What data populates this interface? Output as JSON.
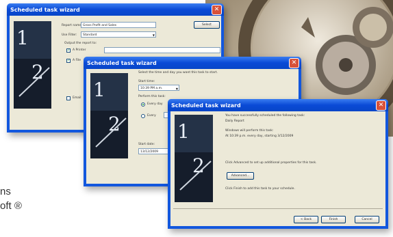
{
  "side_text": {
    "line1": "ns",
    "line2": "oft ®"
  },
  "icons": {
    "close": "close-icon",
    "dropdown": "chevron-down-icon",
    "artwork": "clock-artwork"
  },
  "colors": {
    "xp_titlebar": "#0a4ad6",
    "xp_face": "#ece9d8",
    "close_button": "#d8523a"
  },
  "window1": {
    "title": "Scheduled task wizard",
    "report_name_label": "Report name:",
    "report_name_value": "Gross Profit and Sales",
    "select_button": "Select",
    "use_filter_label": "Use Filter:",
    "use_filter_value": "Standard",
    "output_group_label": "Output the report to:",
    "option_printer": "A Printer",
    "option_file": "A File",
    "option_email": "Email"
  },
  "window2": {
    "title": "Scheduled task wizard",
    "prompt": "Select the time and day you want this task to start.",
    "start_time_label": "Start time:",
    "start_time_value": "10:39 PM a.m.",
    "perform_label": "Perform this task:",
    "option_every_day": "Every day",
    "option_every": "Every",
    "start_date_label": "Start date:",
    "start_date_value": "13/12/2009"
  },
  "window3": {
    "title": "Scheduled task wizard",
    "line1": "You have successfully scheduled the following task:",
    "line2": "Daily Report",
    "line3": "Windows will perform this task:",
    "line4": "At 10:39 p.m. every day, starting 3/12/2009",
    "line5": "Click Advanced to set up additional properties for this task.",
    "advanced_button": "Advanced...",
    "line6": "Click Finish to add this task to your schedule.",
    "back_button": "< Back",
    "finish_button": "Finish",
    "cancel_button": "Cancel"
  }
}
